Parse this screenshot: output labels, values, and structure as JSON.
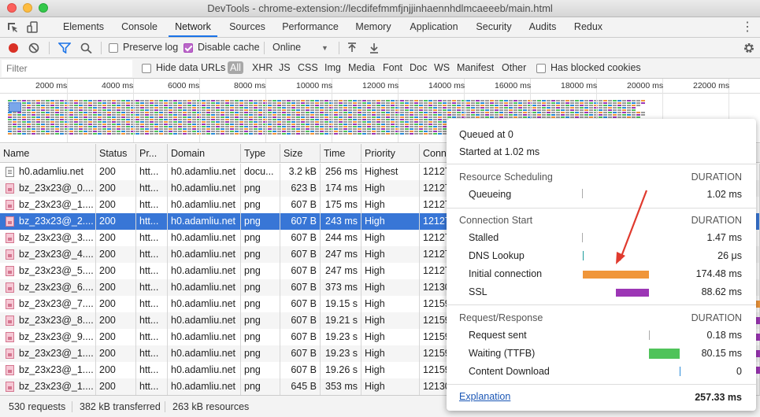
{
  "window": {
    "title": "DevTools - chrome-extension://lecdifefmmfjnjjinhaennhdlmcaeeeb/main.html"
  },
  "panel_tabs": [
    "Elements",
    "Console",
    "Network",
    "Sources",
    "Performance",
    "Memory",
    "Application",
    "Security",
    "Audits",
    "Redux"
  ],
  "active_tab": "Network",
  "toolbar": {
    "preserve_log": "Preserve log",
    "disable_cache": "Disable cache",
    "throttle": "Online"
  },
  "filter": {
    "placeholder": "Filter",
    "hide_data_urls": "Hide data URLs",
    "types": [
      "All",
      "XHR",
      "JS",
      "CSS",
      "Img",
      "Media",
      "Font",
      "Doc",
      "WS",
      "Manifest",
      "Other"
    ],
    "has_blocked_cookies": "Has blocked cookies"
  },
  "overview": {
    "ticks": [
      "2000 ms",
      "4000 ms",
      "6000 ms",
      "8000 ms",
      "10000 ms",
      "12000 ms",
      "14000 ms",
      "16000 ms",
      "18000 ms",
      "20000 ms",
      "22000 ms"
    ]
  },
  "columns": [
    "Name",
    "Status",
    "Pr...",
    "Domain",
    "Type",
    "Size",
    "Time",
    "Priority",
    "Conn"
  ],
  "rows": [
    {
      "name": "h0.adamliu.net",
      "status": "200",
      "proto": "htt...",
      "domain": "h0.adamliu.net",
      "type": "docu...",
      "size": "3.2 kB",
      "time": "256 ms",
      "priority": "Highest",
      "conn": "12127",
      "icon": "doc"
    },
    {
      "name": "bz_23x23@_0....",
      "status": "200",
      "proto": "htt...",
      "domain": "h0.adamliu.net",
      "type": "png",
      "size": "623 B",
      "time": "174 ms",
      "priority": "High",
      "conn": "12127",
      "icon": "img"
    },
    {
      "name": "bz_23x23@_1....",
      "status": "200",
      "proto": "htt...",
      "domain": "h0.adamliu.net",
      "type": "png",
      "size": "607 B",
      "time": "175 ms",
      "priority": "High",
      "conn": "12127",
      "icon": "img"
    },
    {
      "name": "bz_23x23@_2....",
      "status": "200",
      "proto": "htt...",
      "domain": "h0.adamliu.net",
      "type": "png",
      "size": "607 B",
      "time": "243 ms",
      "priority": "High",
      "conn": "12127",
      "icon": "img",
      "selected": true
    },
    {
      "name": "bz_23x23@_3....",
      "status": "200",
      "proto": "htt...",
      "domain": "h0.adamliu.net",
      "type": "png",
      "size": "607 B",
      "time": "244 ms",
      "priority": "High",
      "conn": "12127",
      "icon": "img"
    },
    {
      "name": "bz_23x23@_4....",
      "status": "200",
      "proto": "htt...",
      "domain": "h0.adamliu.net",
      "type": "png",
      "size": "607 B",
      "time": "247 ms",
      "priority": "High",
      "conn": "12127",
      "icon": "img"
    },
    {
      "name": "bz_23x23@_5....",
      "status": "200",
      "proto": "htt...",
      "domain": "h0.adamliu.net",
      "type": "png",
      "size": "607 B",
      "time": "247 ms",
      "priority": "High",
      "conn": "12127",
      "icon": "img"
    },
    {
      "name": "bz_23x23@_6....",
      "status": "200",
      "proto": "htt...",
      "domain": "h0.adamliu.net",
      "type": "png",
      "size": "607 B",
      "time": "373 ms",
      "priority": "High",
      "conn": "12130",
      "icon": "img"
    },
    {
      "name": "bz_23x23@_7....",
      "status": "200",
      "proto": "htt...",
      "domain": "h0.adamliu.net",
      "type": "png",
      "size": "607 B",
      "time": "19.15 s",
      "priority": "High",
      "conn": "12159",
      "icon": "img"
    },
    {
      "name": "bz_23x23@_8....",
      "status": "200",
      "proto": "htt...",
      "domain": "h0.adamliu.net",
      "type": "png",
      "size": "607 B",
      "time": "19.21 s",
      "priority": "High",
      "conn": "12159",
      "icon": "img"
    },
    {
      "name": "bz_23x23@_9....",
      "status": "200",
      "proto": "htt...",
      "domain": "h0.adamliu.net",
      "type": "png",
      "size": "607 B",
      "time": "19.23 s",
      "priority": "High",
      "conn": "12159",
      "icon": "img"
    },
    {
      "name": "bz_23x23@_1....",
      "status": "200",
      "proto": "htt...",
      "domain": "h0.adamliu.net",
      "type": "png",
      "size": "607 B",
      "time": "19.23 s",
      "priority": "High",
      "conn": "12159",
      "icon": "img"
    },
    {
      "name": "bz_23x23@_1....",
      "status": "200",
      "proto": "htt...",
      "domain": "h0.adamliu.net",
      "type": "png",
      "size": "607 B",
      "time": "19.26 s",
      "priority": "High",
      "conn": "12159",
      "icon": "img"
    },
    {
      "name": "bz_23x23@_1....",
      "status": "200",
      "proto": "htt...",
      "domain": "h0.adamliu.net",
      "type": "png",
      "size": "645 B",
      "time": "353 ms",
      "priority": "High",
      "conn": "12130",
      "icon": "img"
    }
  ],
  "status_bar": {
    "requests": "530 requests",
    "transferred": "382 kB transferred",
    "resources": "263 kB resources"
  },
  "timing": {
    "queued_at": "Queued at 0",
    "started_at": "Started at 1.02 ms",
    "duration_label": "DURATION",
    "sections": [
      {
        "title": "Resource Scheduling",
        "rows": [
          {
            "label": "Queueing",
            "value": "1.02 ms"
          }
        ]
      },
      {
        "title": "Connection Start",
        "rows": [
          {
            "label": "Stalled",
            "value": "1.47 ms"
          },
          {
            "label": "DNS Lookup",
            "value": "26 μs"
          },
          {
            "label": "Initial connection",
            "value": "174.48 ms"
          },
          {
            "label": "SSL",
            "value": "88.62 ms"
          }
        ]
      },
      {
        "title": "Request/Response",
        "rows": [
          {
            "label": "Request sent",
            "value": "0.18 ms"
          },
          {
            "label": "Waiting (TTFB)",
            "value": "80.15 ms"
          },
          {
            "label": "Content Download",
            "value": "0"
          }
        ]
      }
    ],
    "explanation": "Explanation",
    "total": "257.33 ms"
  },
  "colors": {
    "accent": "#1a73e8",
    "selected_row": "#3876d6",
    "initial_connection": "#f0963a",
    "ssl": "#9c36b5",
    "ttfb": "#4fc35a",
    "content_download": "#2b8bd9",
    "annotation_arrow": "#e03a2e"
  }
}
